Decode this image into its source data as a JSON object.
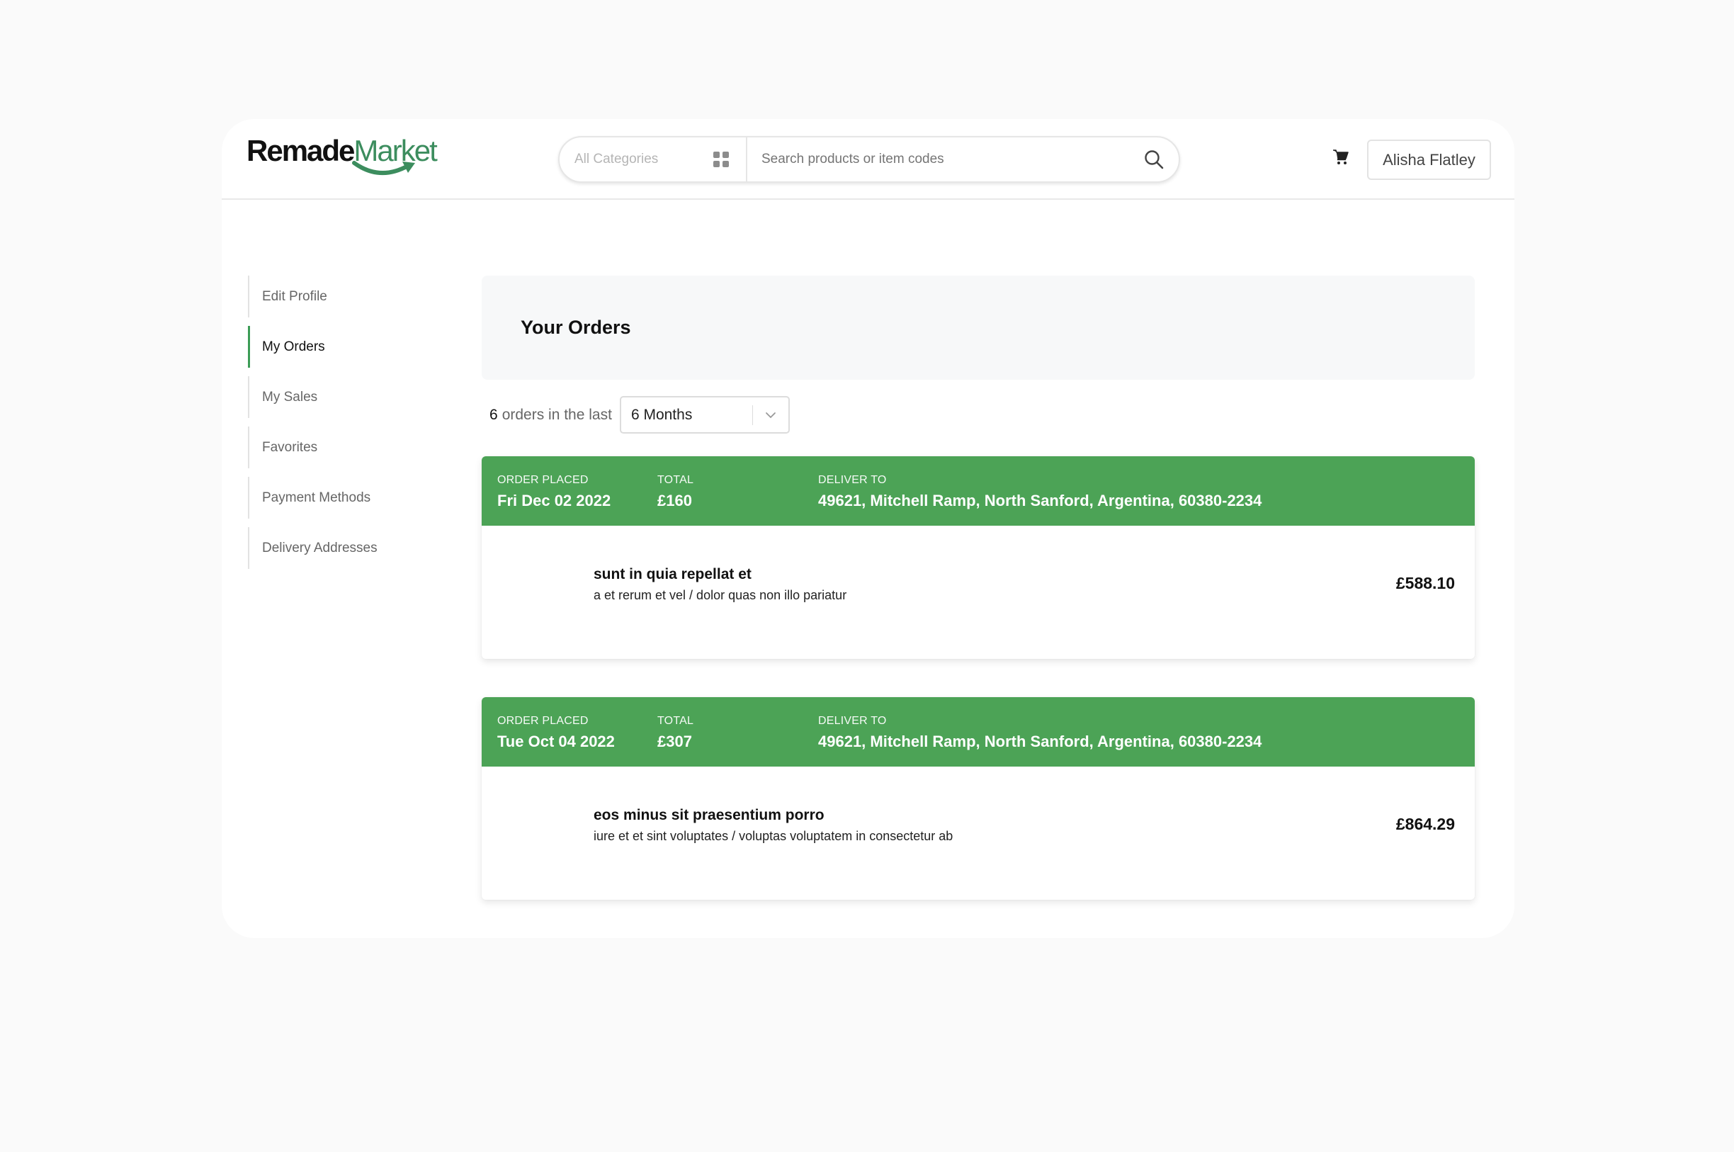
{
  "header": {
    "logo": {
      "part1": "Remade",
      "part2": "Market"
    },
    "search": {
      "category_label": "All Categories",
      "placeholder": "Search products or item codes"
    },
    "user_name": "Alisha Flatley",
    "accent_color": "#4ca356"
  },
  "sidebar": {
    "items": [
      {
        "label": "Edit Profile",
        "active": false
      },
      {
        "label": "My Orders",
        "active": true
      },
      {
        "label": "My Sales",
        "active": false
      },
      {
        "label": "Favorites",
        "active": false
      },
      {
        "label": "Payment Methods",
        "active": false
      },
      {
        "label": "Delivery Addresses",
        "active": false
      }
    ]
  },
  "main": {
    "title": "Your Orders",
    "filter": {
      "count": "6",
      "text": "orders in the last",
      "period": "6 Months"
    },
    "orders": [
      {
        "placed_label": "ORDER PLACED",
        "placed": "Fri Dec 02 2022",
        "total_label": "TOTAL",
        "total": "£160",
        "deliver_label": "DELIVER TO",
        "deliver": "49621, Mitchell Ramp, North Sanford, Argentina, 60380-2234",
        "item_name": "sunt in quia repellat et",
        "item_desc": "a et rerum et vel / dolor quas non illo pariatur",
        "item_price": "£588.10"
      },
      {
        "placed_label": "ORDER PLACED",
        "placed": "Tue Oct 04 2022",
        "total_label": "TOTAL",
        "total": "£307",
        "deliver_label": "DELIVER TO",
        "deliver": "49621, Mitchell Ramp, North Sanford, Argentina, 60380-2234",
        "item_name": "eos minus sit praesentium porro",
        "item_desc": "iure et et sint voluptates / voluptas voluptatem in consectetur ab",
        "item_price": "£864.29"
      }
    ]
  }
}
